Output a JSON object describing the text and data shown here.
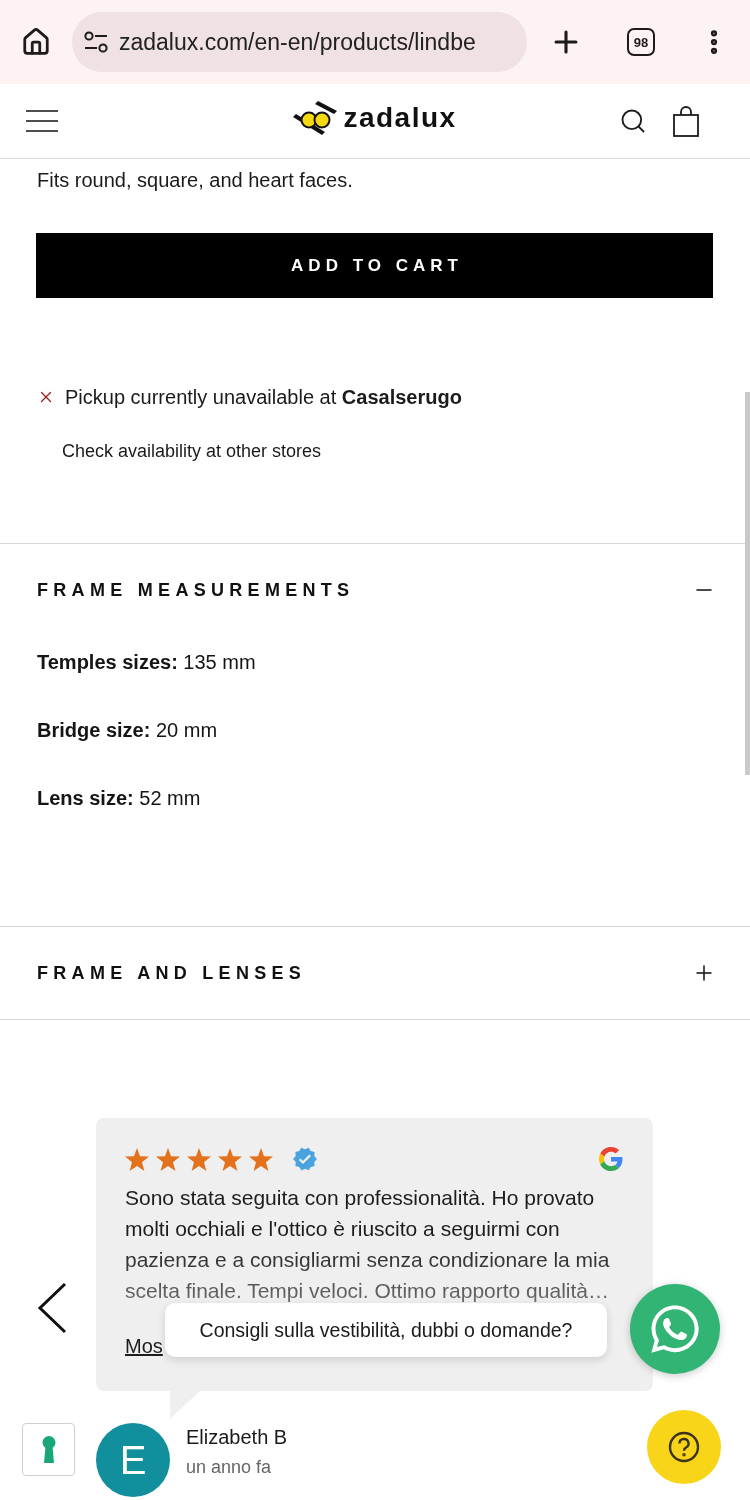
{
  "browser": {
    "url": "zadalux.com/en-en/products/lindbe",
    "tab_count": "98"
  },
  "header": {
    "logo": "zadalux"
  },
  "product": {
    "fit_note": "Fits round, square, and heart faces.",
    "add_to_cart": "ADD TO CART",
    "pickup": {
      "available": false,
      "message": "Pickup currently unavailable at **Casalserugo**",
      "link": "Check availability at other stores"
    }
  },
  "accordions": [
    {
      "title": "FRAME MEASUREMENTS",
      "expanded": true,
      "rows": [
        "**Temples sizes:** 135 mm",
        "**Bridge size:** 20 mm",
        "**Lens size:** 52 mm"
      ]
    },
    {
      "title": "FRAME AND LENSES",
      "expanded": false
    }
  ],
  "review": {
    "stars": 5,
    "verified": true,
    "text": "Sono stata seguita con professionalità. Ho provato molti occhiali e l'ottico è riuscito a seguirmi con pazienza e a consigliarmi senza condizionare la mia scelta finale. Tempi veloci. Ottimo rapporto qualità…",
    "more_link": "Mos",
    "author": {
      "initial": "E",
      "name": "Elizabeth B",
      "time": "un anno fa"
    }
  },
  "chat_prompt": "Consigli sulla vestibilità, dubbi o domande?"
}
